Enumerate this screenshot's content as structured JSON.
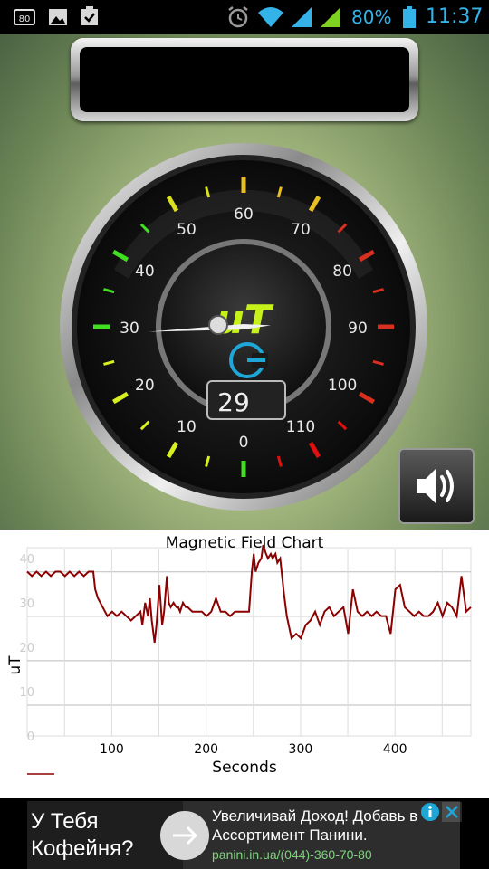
{
  "status_bar": {
    "left_icons": [
      "hd-icon",
      "image-icon",
      "clipboard-check-icon"
    ],
    "right_icons": [
      "alarm-icon",
      "wifi-icon",
      "signal-icon",
      "signal-icon",
      "battery-icon"
    ],
    "battery": "80%",
    "time": "11:37"
  },
  "gauge": {
    "unit": "uT",
    "value": "29",
    "reading": 29,
    "scale_labels": [
      "0",
      "10",
      "20",
      "30",
      "40",
      "50",
      "60",
      "70",
      "80",
      "90",
      "100",
      "110"
    ]
  },
  "sound_button": {
    "icon": "speaker-icon"
  },
  "chart_data": {
    "type": "line",
    "title": "Magnetic Field Chart",
    "xlabel": "Seconds",
    "ylabel": "uT",
    "xlim": [
      20,
      490
    ],
    "ylim": [
      0,
      42
    ],
    "x_ticks": [
      "100",
      "200",
      "300",
      "400"
    ],
    "y_ticks": [
      "0",
      "10",
      "20",
      "30",
      "40"
    ],
    "grid": true,
    "series": [
      {
        "name": "",
        "color": "#8b0000",
        "x": [
          20,
          25,
          30,
          35,
          40,
          45,
          50,
          55,
          60,
          65,
          70,
          75,
          80,
          85,
          90,
          92,
          95,
          100,
          105,
          110,
          115,
          120,
          125,
          130,
          135,
          140,
          142,
          145,
          148,
          150,
          152,
          155,
          157,
          160,
          163,
          165,
          168,
          170,
          172,
          175,
          178,
          180,
          182,
          185,
          188,
          190,
          195,
          200,
          205,
          210,
          215,
          220,
          225,
          230,
          235,
          240,
          242,
          245,
          250,
          255,
          258,
          260,
          262,
          265,
          268,
          270,
          273,
          275,
          278,
          280,
          283,
          285,
          288,
          290,
          292,
          295,
          300,
          305,
          310,
          315,
          320,
          325,
          330,
          335,
          340,
          345,
          350,
          355,
          360,
          365,
          370,
          375,
          380,
          385,
          390,
          395,
          400,
          405,
          410,
          415,
          420,
          425,
          430,
          435,
          440,
          445,
          450,
          455,
          460,
          465,
          470,
          475,
          480,
          485,
          490
        ],
        "values": [
          37,
          36,
          37,
          36,
          37,
          36,
          37,
          37,
          36,
          37,
          36,
          37,
          36,
          37,
          37,
          33,
          31,
          29,
          27,
          28,
          27,
          28,
          27,
          26,
          27,
          28,
          25,
          30,
          27,
          31,
          26,
          21,
          25,
          34,
          25,
          28,
          36,
          30,
          29,
          30,
          29,
          29,
          28,
          30,
          29,
          29,
          28,
          28,
          28,
          27,
          28,
          31,
          28,
          28,
          27,
          28,
          28,
          28,
          28,
          28,
          37,
          41,
          37,
          39,
          40,
          43,
          41,
          40,
          41,
          40,
          41,
          39,
          40,
          36,
          32,
          27,
          22,
          23,
          22,
          25,
          26,
          28,
          25,
          28,
          29,
          27,
          28,
          29,
          23,
          33,
          28,
          27,
          28,
          27,
          28,
          27,
          27,
          23,
          33,
          34,
          29,
          28,
          27,
          28,
          27,
          27,
          28,
          30,
          27,
          30,
          29,
          27,
          36,
          28,
          29
        ]
      }
    ]
  },
  "ad": {
    "left_text": "У Тебя\nКофейня?",
    "headline": "Увеличивай Доход! Добавь в\nАссортимент Панини.",
    "url": "panini.in.ua/(044)-360-70-80",
    "arrow_icon": "arrow-right-icon",
    "info_icon": "info-icon",
    "close_icon": "close-icon"
  }
}
